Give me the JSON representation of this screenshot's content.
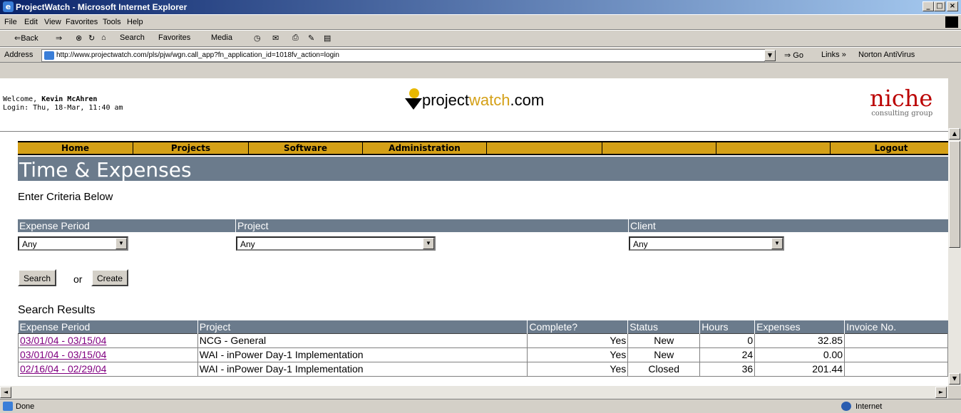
{
  "window": {
    "title": "ProjectWatch - Microsoft Internet Explorer",
    "minimize": "_",
    "maximize": "□",
    "close": "×"
  },
  "menu": [
    "File",
    "Edit",
    "View",
    "Favorites",
    "Tools",
    "Help"
  ],
  "toolbar": {
    "back": "⇐Back",
    "forward": "⇒",
    "search": "Search",
    "favorites": "Favorites",
    "media": "Media"
  },
  "address": {
    "label": "Address",
    "url": "http://www.projectwatch.com/pls/pjw/wgn.call_app?fn_application_id=1018fv_action=login",
    "go": "Go",
    "links": "Links",
    "norton": "Norton AntiVirus"
  },
  "header": {
    "welcome_prefix": "Welcome, ",
    "user": "Kevin McAhren",
    "login": "Login: Thu, 18-Mar, 11:40 am",
    "logo_a": "project",
    "logo_b": "watch",
    "logo_c": ".com",
    "niche": "niche",
    "niche_sub": "consulting group"
  },
  "nav": [
    "Home",
    "Projects",
    "Software",
    "Administration",
    "",
    "",
    "",
    "Logout"
  ],
  "page": {
    "title": "Time & Expenses",
    "criteria": "Enter Criteria Below"
  },
  "filters": {
    "expense_period": {
      "label": "Expense Period",
      "value": "Any"
    },
    "project": {
      "label": "Project",
      "value": "Any"
    },
    "client": {
      "label": "Client",
      "value": "Any"
    }
  },
  "buttons": {
    "search": "Search",
    "or": "or",
    "create": "Create"
  },
  "results": {
    "title": "Search Results",
    "columns": [
      "Expense Period",
      "Project",
      "Complete?",
      "Status",
      "Hours",
      "Expenses",
      "Invoice No."
    ],
    "rows": [
      {
        "period": "03/01/04 - 03/15/04",
        "project": "NCG - General",
        "complete": "Yes",
        "status": "New",
        "hours": "0",
        "expenses": "32.85",
        "invoice": ""
      },
      {
        "period": "03/01/04 - 03/15/04",
        "project": "WAI - inPower Day-1 Implementation",
        "complete": "Yes",
        "status": "New",
        "hours": "24",
        "expenses": "0.00",
        "invoice": ""
      },
      {
        "period": "02/16/04 - 02/29/04",
        "project": "WAI - inPower Day-1 Implementation",
        "complete": "Yes",
        "status": "Closed",
        "hours": "36",
        "expenses": "201.44",
        "invoice": ""
      }
    ]
  },
  "status": {
    "left": "Done",
    "zone": "Internet"
  }
}
